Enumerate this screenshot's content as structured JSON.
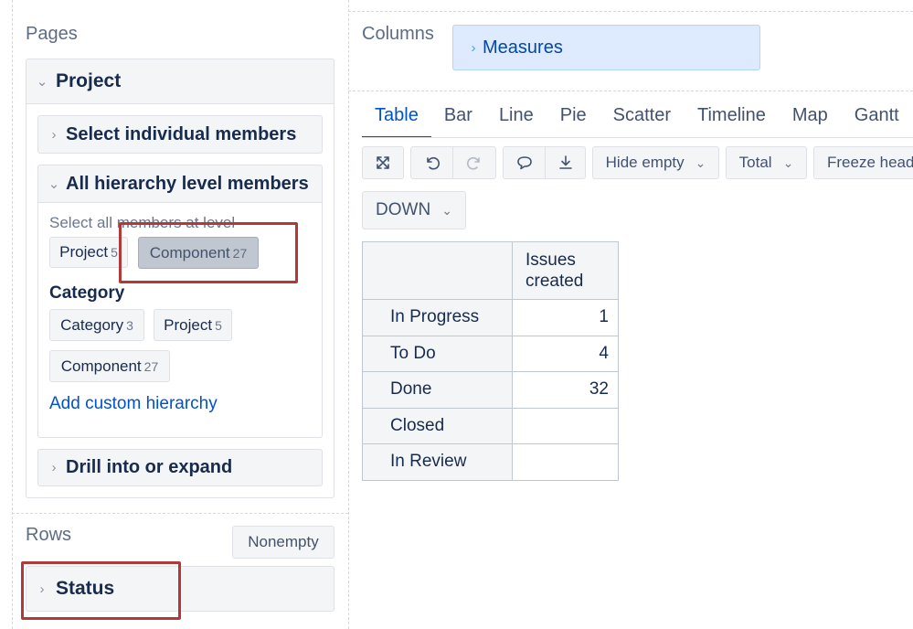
{
  "pages": {
    "label": "Pages",
    "project_header": "Project",
    "select_individual": "Select individual members",
    "all_hierarchy": "All hierarchy level members",
    "select_all_label": "Select all members at level",
    "level_chips": [
      {
        "name": "Project",
        "count": "5"
      },
      {
        "name": "Component",
        "count": "27"
      }
    ],
    "category_label": "Category",
    "category_chips": [
      {
        "name": "Category",
        "count": "3"
      },
      {
        "name": "Project",
        "count": "5"
      },
      {
        "name": "Component",
        "count": "27"
      }
    ],
    "add_custom": "Add custom hierarchy",
    "drill_into": "Drill into or expand"
  },
  "rows": {
    "label": "Rows",
    "nonempty_label": "Nonempty",
    "status_header": "Status"
  },
  "columns": {
    "label": "Columns",
    "measures_label": "Measures"
  },
  "view_tabs": [
    "Table",
    "Bar",
    "Line",
    "Pie",
    "Scatter",
    "Timeline",
    "Map",
    "Gantt"
  ],
  "active_tab": "Table",
  "toolbar": {
    "hide_empty_label": "Hide empty",
    "total_label": "Total",
    "freeze_label": "Freeze head",
    "down_label": "DOWN"
  },
  "icons": [
    "expand-icon",
    "undo-icon",
    "redo-icon",
    "comment-icon",
    "download-icon",
    "chevron-down-icon",
    "chevron-right-icon"
  ],
  "table": {
    "column_header_line1": "Issues",
    "column_header_line2": "created",
    "rows": [
      {
        "label": "In Progress",
        "value": "1"
      },
      {
        "label": "To Do",
        "value": "4"
      },
      {
        "label": "Done",
        "value": "32"
      },
      {
        "label": "Closed",
        "value": ""
      },
      {
        "label": "In Review",
        "value": ""
      }
    ]
  },
  "colors": {
    "highlight_box": "#b03a3a",
    "link": "#0052cc",
    "measures_bg": "#deebff"
  }
}
